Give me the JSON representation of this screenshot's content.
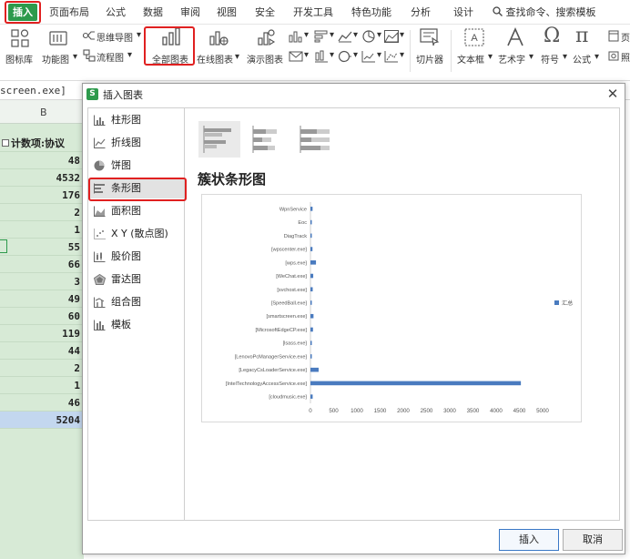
{
  "menubar": {
    "items": [
      "插入",
      "页面布局",
      "公式",
      "数据",
      "审阅",
      "视图",
      "安全",
      "开发工具",
      "特色功能",
      "分析",
      "设计"
    ],
    "search": "查找命令、搜索模板"
  },
  "ribbon": {
    "icon_lib": "图标库",
    "func_chart": "功能图",
    "mindmap": "思维导图",
    "flowchart": "流程图",
    "all_charts": "全部图表",
    "online_chart": "在线图表",
    "demo_chart": "演示图表",
    "slicer": "切片器",
    "textbox": "文本框",
    "wordart": "艺术字",
    "symbol": "符号",
    "formula": "公式",
    "header_footer": "页",
    "camera": "照"
  },
  "sheet": {
    "formula_text": "screen.exe]",
    "col_label": "B",
    "header_cell": "计数项:协议",
    "values": [
      "48",
      "4532",
      "176",
      "2",
      "1",
      "55",
      "66",
      "3",
      "49",
      "60",
      "119",
      "44",
      "2",
      "1",
      "46"
    ],
    "total": "5204"
  },
  "dialog": {
    "title": "插入图表",
    "types": [
      {
        "label": "柱形图",
        "icon": "column-chart-icon"
      },
      {
        "label": "折线图",
        "icon": "line-chart-icon"
      },
      {
        "label": "饼图",
        "icon": "pie-chart-icon"
      },
      {
        "label": "条形图",
        "icon": "bar-chart-icon"
      },
      {
        "label": "面积图",
        "icon": "area-chart-icon"
      },
      {
        "label": "X Y (散点图)",
        "icon": "scatter-chart-icon"
      },
      {
        "label": "股价图",
        "icon": "stock-chart-icon"
      },
      {
        "label": "雷达图",
        "icon": "radar-chart-icon"
      },
      {
        "label": "组合图",
        "icon": "combo-chart-icon"
      },
      {
        "label": "模板",
        "icon": "template-icon"
      }
    ],
    "selected_type": "条形图",
    "chart_heading": "簇状条形图",
    "insert_label": "插入",
    "cancel_label": "取消"
  },
  "chart_data": {
    "type": "bar",
    "orientation": "horizontal",
    "categories": [
      "WpnService",
      "Eoc",
      "DiagTrack",
      "[wpscenter.exe]",
      "[wps.exe]",
      "[WeChat.exe]",
      "[svchost.exe]",
      "[SpeedBall.exe]",
      "[smartscreen.exe]",
      "[MicrosoftEdgeCP.exe]",
      "[lsass.exe]",
      "[LenovoPcManagerService.exe]",
      "[LegacyCsLoaderService.exe]",
      "[IntelTechnologyAccessService.exe]",
      "[cloudmusic.exe]"
    ],
    "series": [
      {
        "name": "汇总",
        "values": [
          46,
          1,
          2,
          44,
          119,
          60,
          49,
          3,
          66,
          55,
          1,
          2,
          176,
          4532,
          48
        ],
        "color": "#4a7bbf"
      }
    ],
    "xlim": [
      0,
      5000
    ],
    "xticks": [
      0,
      500,
      1000,
      1500,
      2000,
      2500,
      3000,
      3500,
      4000,
      4500,
      5000
    ],
    "legend": "right",
    "grid": false
  }
}
